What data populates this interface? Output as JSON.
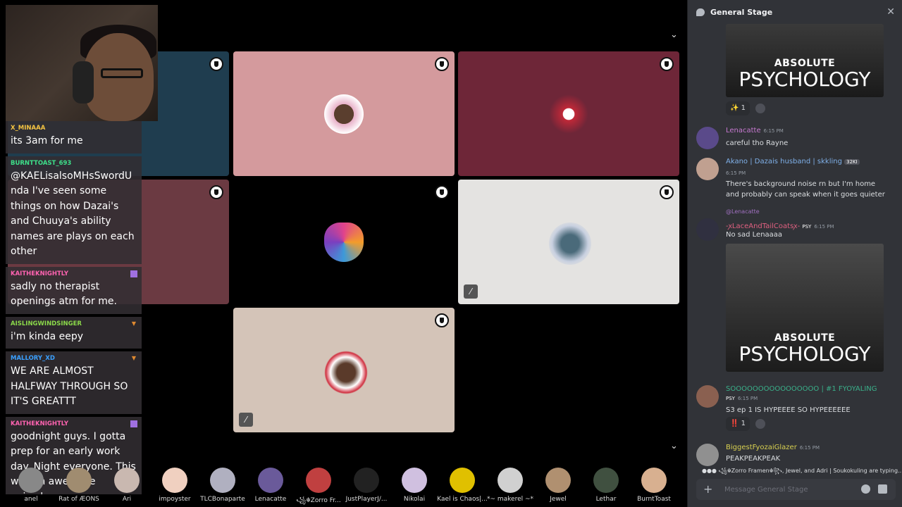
{
  "chat_overlay": {
    "messages": [
      {
        "name": "X_MINAAA",
        "color": "#f5c542",
        "text": "its 3am for me"
      },
      {
        "name": "BURNTTOAST_693",
        "color": "#3ee08a",
        "text": "@KAELisalsoMHsSwordUnda I've seen some things on how Dazai's and Chuuya's ability names are plays on each other"
      },
      {
        "name": "KAITHEKNIGHTLY",
        "color": "#ff63b1",
        "text": "sadly no therapist openings atm for me."
      },
      {
        "name": "AISLINGWINDSINGER",
        "color": "#8bd94a",
        "text": "i'm kinda eepy"
      },
      {
        "name": "MALLORY_XD",
        "color": "#3aa0ff",
        "text": "WE ARE ALMOST HALFWAY THROUGH SO IT'S GREATTT"
      },
      {
        "name": "KAITHEKNIGHTLY",
        "color": "#ff63b1",
        "text": "goodnight guys. I gotta prep for an early work day. Night everyone. This was an awesome episode."
      }
    ]
  },
  "audience": [
    {
      "name": "anel",
      "color": "#888"
    },
    {
      "name": "Rat of ÆONS",
      "color": "#a08c70"
    },
    {
      "name": "Ari",
      "color": "#c9b8b0"
    },
    {
      "name": "impoyster",
      "color": "#f0d0c0"
    },
    {
      "name": "TLCBonaparte",
      "color": "#b0b0c0"
    },
    {
      "name": "Lenacatte",
      "color": "#6a5a9a"
    },
    {
      "name": "꧁☬Zorro Fr...",
      "color": "#c04040"
    },
    {
      "name": "JustPlayerJ/...",
      "color": "#222"
    },
    {
      "name": "Nikolai",
      "color": "#d0c0e0"
    },
    {
      "name": "Kael is Chaos|...",
      "color": "#e0c000"
    },
    {
      "name": "*~ makerel ~*",
      "color": "#d0d0d0"
    },
    {
      "name": "Jewel",
      "color": "#b09070"
    },
    {
      "name": "Lethar",
      "color": "#405040"
    },
    {
      "name": "BurntToast",
      "color": "#d8b090"
    }
  ],
  "panel": {
    "title": "General Stage",
    "meme_line1": "ABSOLUTE",
    "meme_line2": "PSYCHOLOGY",
    "reaction1": "✨ 1",
    "msg_lena": {
      "name": "Lenacatte",
      "time": "6:15 PM",
      "text": "careful tho Rayne"
    },
    "msg_akano": {
      "name": "Akano | Dazais husband | skkling",
      "tag": "32KI",
      "time": "6:15 PM",
      "text": "There's background noise rn but I'm home and probably can speak when it goes quieter"
    },
    "reply_to": "@Lenacatte",
    "msg_lace": {
      "name": "-ꭗLaceAndTailCoatsꭗ-",
      "tag": "PSY",
      "time": "6:15 PM",
      "text": "No sad Lenaaaa"
    },
    "msg_soo": {
      "name": "SOOOOOOOOOOOOOOOO | #1 FYOYALING",
      "tag": "PSY",
      "time": "6:15 PM",
      "text": "S3 ep 1 IS HYPEEEE SO HYPEEEEEE"
    },
    "reaction2": "‼️ 1",
    "msg_big": {
      "name": "BiggestFyozaiGlazer",
      "time": "6:15 PM",
      "text": "PEAKPEAKPEAK"
    },
    "typing": "꧁☬Zorro Framen☬꧂, Jewel, and Adri | Soukokuling are typing...",
    "composer_placeholder": "Message General Stage"
  }
}
